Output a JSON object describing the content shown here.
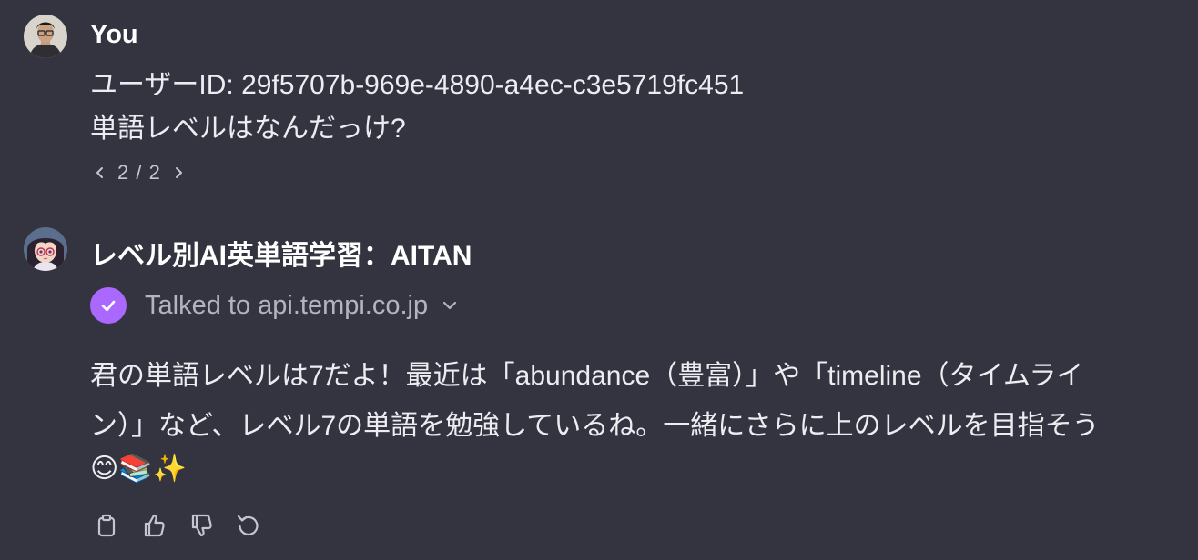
{
  "user_message": {
    "author": "You",
    "lines": [
      "ユーザーID: 29f5707b-969e-4890-a4ec-c3e5719fc451",
      "単語レベルはなんだっけ?"
    ],
    "pager": "2 / 2"
  },
  "assistant_message": {
    "author": "レベル別AI英単語学習：AITAN",
    "plugin_status": "Talked to api.tempi.co.jp",
    "lines": [
      "君の単語レベルは7だよ！最近は「abundance（豊富）」や「timeline（タイムライ",
      "ン）」など、レベル7の単語を勉強しているね。一緒にさらに上のレベルを目指そう",
      "😊📚✨"
    ]
  },
  "colors": {
    "background": "#343441",
    "text": "#ececf1",
    "muted": "#b4b4c0",
    "plugin_accent": "#ab68ff"
  },
  "icons": {
    "user_avatar": "user-photo-avatar",
    "assistant_avatar": "anime-girl-avatar",
    "pager_prev": "chevron-left-icon",
    "pager_next": "chevron-right-icon",
    "plugin_check": "check-icon",
    "plugin_expand": "chevron-down-icon",
    "actions": [
      "clipboard-icon",
      "thumbs-up-icon",
      "thumbs-down-icon",
      "regenerate-icon"
    ]
  }
}
